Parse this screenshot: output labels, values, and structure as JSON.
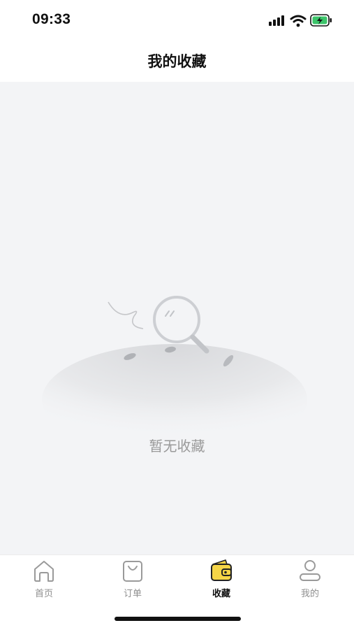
{
  "status_bar": {
    "time": "09:33",
    "icons": [
      "signal-icon",
      "wifi-icon",
      "battery-charging-icon"
    ]
  },
  "header": {
    "title": "我的收藏"
  },
  "empty_state": {
    "message": "暂无收藏",
    "illustration": "empty-search-illustration"
  },
  "tab_bar": {
    "active_color": "#f5d547",
    "items": [
      {
        "label": "首页",
        "icon": "home-icon",
        "active": false
      },
      {
        "label": "订单",
        "icon": "shopping-bag-icon",
        "active": false
      },
      {
        "label": "收藏",
        "icon": "wallet-icon",
        "active": true
      },
      {
        "label": "我的",
        "icon": "user-icon",
        "active": false
      }
    ]
  }
}
